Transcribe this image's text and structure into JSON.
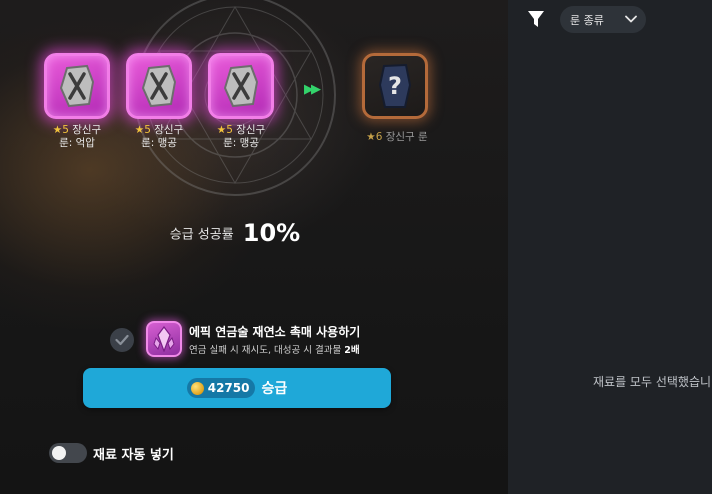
{
  "materials": [
    {
      "star": "★5",
      "name_line1": "장신구",
      "name_line2": "룬: 억압"
    },
    {
      "star": "★5",
      "name_line1": "장신구",
      "name_line2": "룬: 맹공"
    },
    {
      "star": "★5",
      "name_line1": "장신구",
      "name_line2": "룬: 맹공"
    }
  ],
  "result": {
    "star": "★6",
    "name": "장신구 룬"
  },
  "success": {
    "label": "승급 성공률",
    "value": "10%"
  },
  "catalyst": {
    "title": "에픽 연금술 재연소 촉매 사용하기",
    "desc_prefix": "연금 실패 시 재시도, 대성공 시 결과물 ",
    "desc_bold": "2배"
  },
  "upgrade_button": {
    "price": "42750",
    "label": "승급"
  },
  "auto_fill": {
    "label": "재료 자동 넣기",
    "enabled": false
  },
  "filter": {
    "rune_type_label": "룬 종류"
  },
  "empty_message": "재료를 모두 선택했습니다",
  "colors": {
    "accent": "#1fa8d8",
    "epic": "#e95bd9",
    "legend": "#b46a3a",
    "arrow": "#33d36b"
  }
}
